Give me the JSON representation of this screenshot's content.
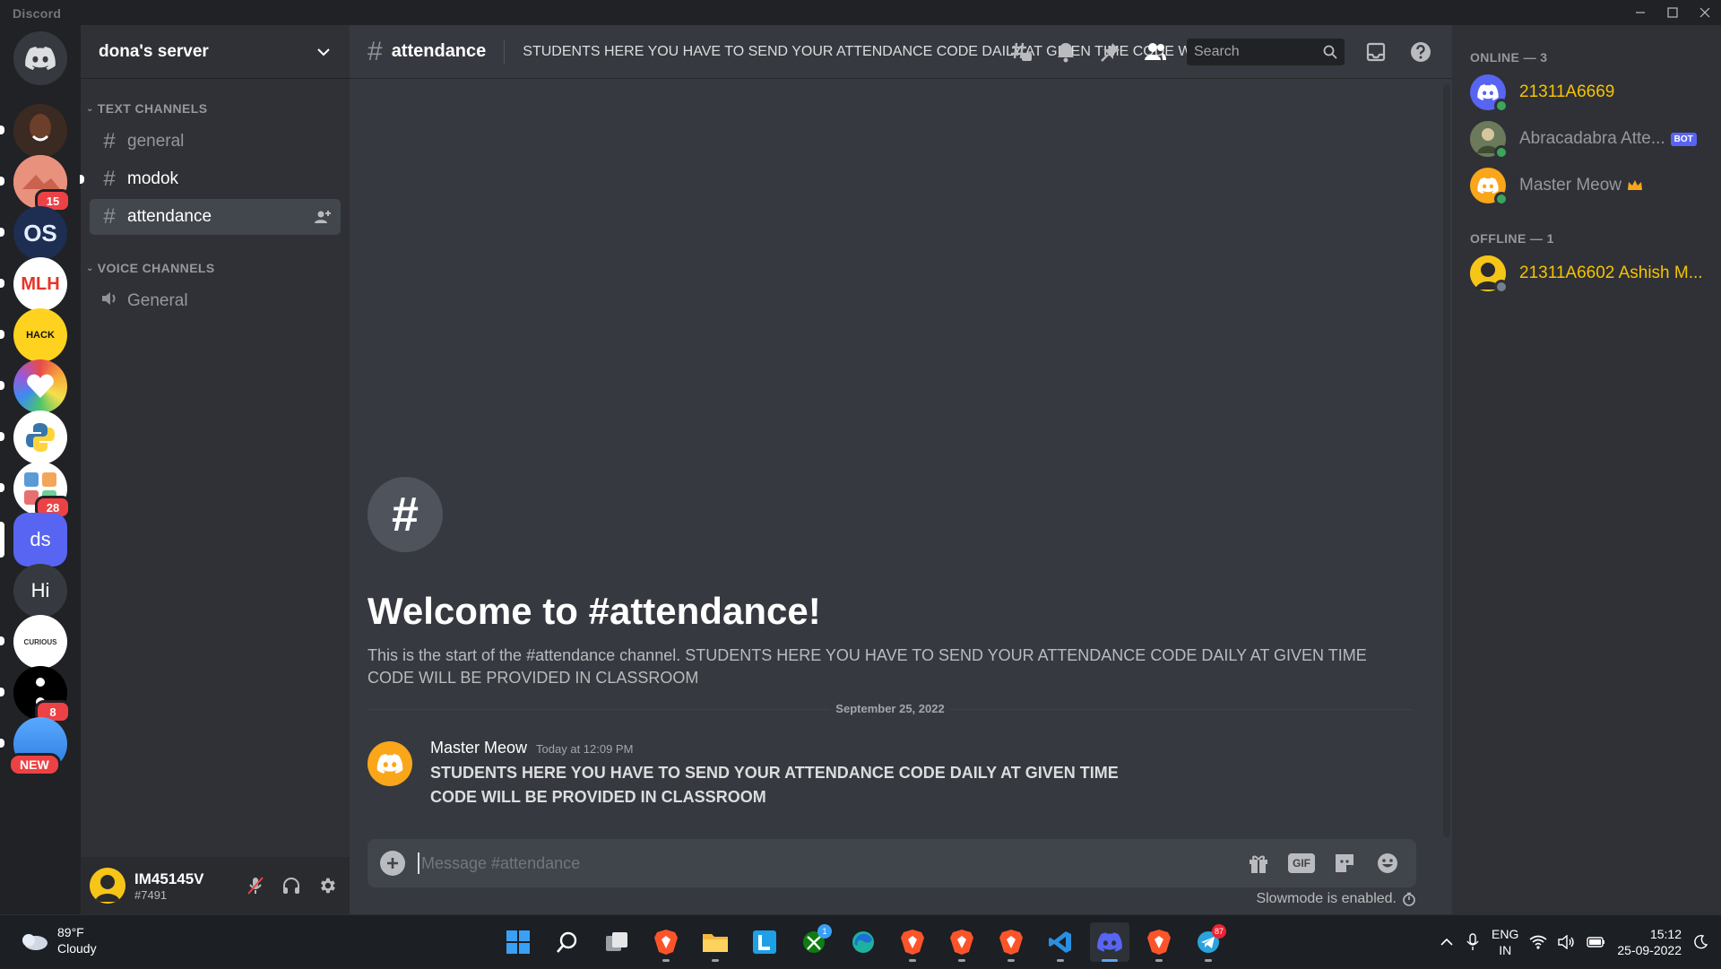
{
  "window": {
    "brand": "Discord"
  },
  "guilds": [
    {
      "kind": "avatar-person",
      "color": "#3b2a22",
      "badge": ""
    },
    {
      "kind": "avatar-pink",
      "color": "#e8917c",
      "badge": "15"
    },
    {
      "kind": "os",
      "color": "#1d2e52",
      "label": "OS",
      "badge": ""
    },
    {
      "kind": "mlh",
      "color": "#ffffff",
      "label": "MLH",
      "badge": ""
    },
    {
      "kind": "hack",
      "color": "#ffd21f",
      "label": "HACK",
      "badge": ""
    },
    {
      "kind": "rainbow",
      "color": "#f0a",
      "badge": ""
    },
    {
      "kind": "python",
      "color": "#ffffff",
      "badge": ""
    },
    {
      "kind": "people",
      "color": "#ffffff",
      "badge": "28"
    },
    {
      "kind": "ds",
      "color": "#5865f2",
      "label": "ds",
      "badge": ""
    },
    {
      "kind": "hi",
      "color": "#36393f",
      "label": "Hi",
      "badge": ""
    },
    {
      "kind": "curious",
      "color": "#ffffff",
      "label": "CURIOUS",
      "badge": ""
    },
    {
      "kind": "dots",
      "color": "#000000",
      "badge": "8"
    },
    {
      "kind": "new",
      "color": "#2b7be0",
      "badge": "NEW"
    }
  ],
  "server": {
    "name": "dona's server",
    "categories": [
      {
        "label": "TEXT CHANNELS"
      },
      {
        "label": "VOICE CHANNELS"
      }
    ],
    "text_channels": [
      {
        "name": "general"
      },
      {
        "name": "modok"
      },
      {
        "name": "attendance"
      }
    ],
    "voice_channels": [
      {
        "name": "General"
      }
    ]
  },
  "user": {
    "name": "IM45145V",
    "tag": "#7491"
  },
  "channel": {
    "name": "attendance",
    "topic": "STUDENTS HERE YOU HAVE TO SEND YOUR ATTENDANCE CODE DAILY AT GIVEN TIME CODE WILL BE PROVIDED IN CLASSROOM",
    "search_placeholder": "Search",
    "welcome_title": "Welcome to #attendance!",
    "welcome_sub": "This is the start of the #attendance channel. STUDENTS HERE YOU HAVE TO SEND YOUR ATTENDANCE CODE DAILY AT GIVEN TIME CODE WILL BE PROVIDED IN CLASSROOM",
    "date_divider": "September 25, 2022"
  },
  "message": {
    "author": "Master Meow",
    "timestamp": "Today at 12:09 PM",
    "line1": "STUDENTS HERE YOU HAVE TO SEND YOUR ATTENDANCE CODE DAILY AT GIVEN TIME",
    "line2": "CODE WILL BE PROVIDED IN CLASSROOM"
  },
  "composer": {
    "placeholder": "Message #attendance",
    "gif_label": "GIF",
    "slowmode": "Slowmode is enabled."
  },
  "members": {
    "online_header": "ONLINE — 3",
    "offline_header": "OFFLINE — 1",
    "online": [
      {
        "name": "21311A6669",
        "color": "#f5c400",
        "avatar": "#5865f2"
      },
      {
        "name": "Abracadabra Atte...",
        "color": "#96989d",
        "bot": "BOT",
        "avatar": "#6b7a5a"
      },
      {
        "name": "Master Meow",
        "color": "#96989d",
        "avatar": "#faa61a"
      }
    ],
    "offline": [
      {
        "name": "21311A6602 Ashish M...",
        "color": "#f5c400",
        "avatar": "#f5c518"
      }
    ]
  },
  "taskbar": {
    "weather_temp": "89°F",
    "weather_desc": "Cloudy",
    "lang1": "ENG",
    "lang2": "IN",
    "time": "15:12",
    "date": "25-09-2022",
    "badges": {
      "xbox": "1",
      "telegram": "87"
    }
  },
  "colors": {
    "accent": "#5865f2",
    "online": "#3ba55d",
    "mention": "#ed4245"
  }
}
